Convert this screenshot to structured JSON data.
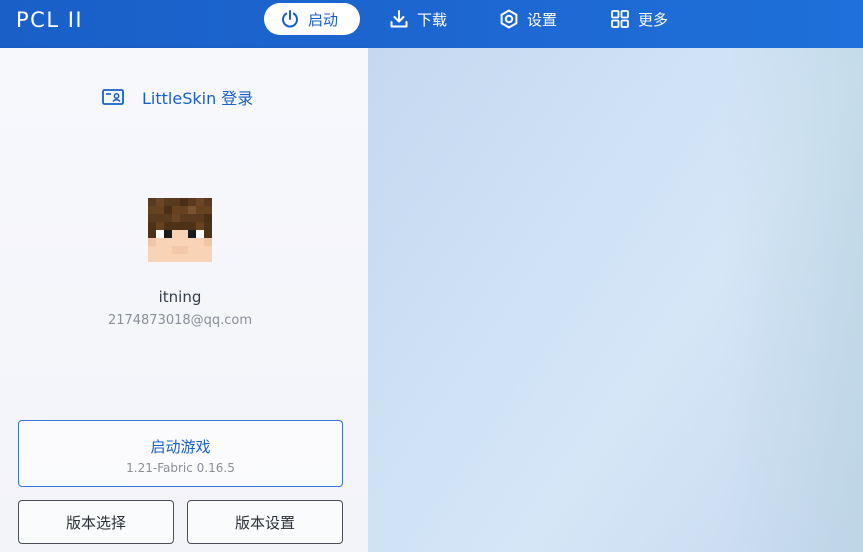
{
  "app": {
    "title": "PCL II"
  },
  "nav": {
    "tabs": [
      {
        "label": "启动",
        "icon": "power-icon",
        "active": true
      },
      {
        "label": "下载",
        "icon": "download-icon",
        "active": false
      },
      {
        "label": "设置",
        "icon": "gear-icon",
        "active": false
      },
      {
        "label": "更多",
        "icon": "grid-icon",
        "active": false
      }
    ]
  },
  "account": {
    "login_label": "LittleSkin 登录",
    "login_icon": "id-card-icon",
    "username": "itning",
    "email": "2174873018@qq.com"
  },
  "launch": {
    "label": "启动游戏",
    "version": "1.21-Fabric 0.16.5"
  },
  "buttons": {
    "version_select": "版本选择",
    "version_settings": "版本设置"
  },
  "colors": {
    "accent": "#1a5fc8",
    "topbar": "#1d67d1",
    "panel_bg": "#f5f6fb",
    "launch_border": "#3474d3"
  }
}
